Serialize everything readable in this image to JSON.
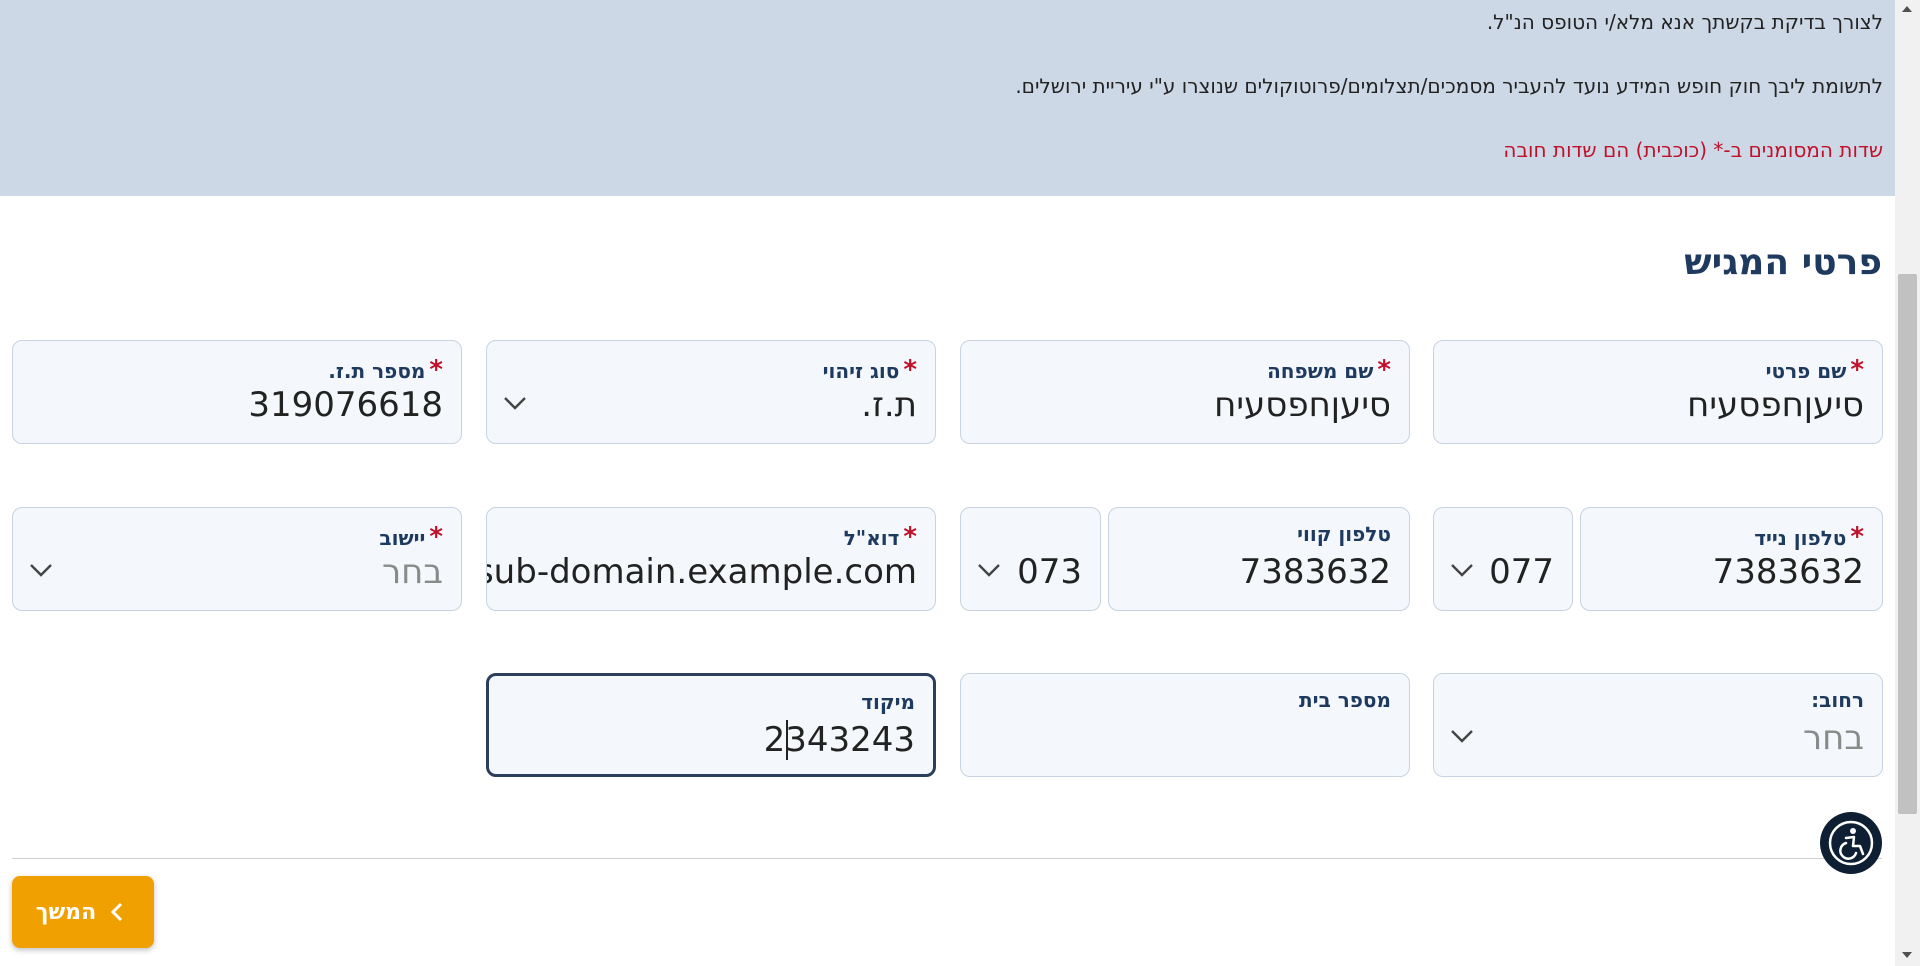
{
  "banner": {
    "line1": "לצורך בדיקת בקשתך אנא מלא/י הטופס הנ\"ל.",
    "line2": "לתשומת ליבך חוק חופש המידע נועד להעביר מסמכים/תצלומים/פרוטוקולים שנוצרו ע\"י עיריית ירושלים.",
    "required_note": "שדות המסומנים ב-* (כוכבית) הם שדות חובה"
  },
  "section": {
    "title": "פרטי המגיש"
  },
  "fields": {
    "first_name": {
      "label": "שם פרטי",
      "value": "סיעןחפסעיח"
    },
    "last_name": {
      "label": "שם משפחה",
      "value": "סיעןחפסעיח"
    },
    "id_type": {
      "label": "סוג זיהוי",
      "value": "ת.ז."
    },
    "id_number": {
      "label": "מספר ת.ז.",
      "value": "319076618"
    },
    "mobile": {
      "label": "טלפון נייד",
      "value": "7383632",
      "prefix": "077"
    },
    "landline": {
      "label": "טלפון קווי",
      "value": "7383632",
      "prefix": "073"
    },
    "email": {
      "label": "דוא\"ל",
      "value": "@sub-domain.example.com"
    },
    "city": {
      "label": "יישוב",
      "placeholder": "בחר"
    },
    "street": {
      "label": "רחוב:",
      "placeholder": "בחר"
    },
    "house_number": {
      "label": "מספר בית",
      "value": ""
    },
    "zip": {
      "label": "מיקוד",
      "value": "2343243"
    }
  },
  "required_mark": "*",
  "actions": {
    "continue_label": "המשך"
  },
  "icons": {
    "chevron": "chevron-down-icon",
    "continue": "chevron-left-icon",
    "accessibility": "accessibility-icon"
  },
  "colors": {
    "banner_bg": "#cdd8e6",
    "required_red": "#c0102a",
    "title_navy": "#1f3a5f",
    "button_orange": "#f0a000"
  }
}
